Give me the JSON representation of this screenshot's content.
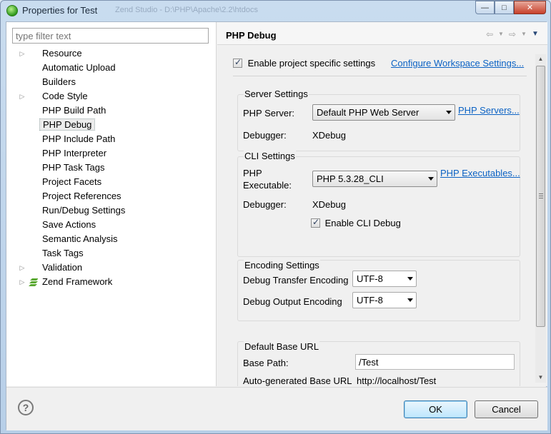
{
  "window": {
    "title": "Properties for Test",
    "ghost_title": "Zend Studio - D:\\PHP\\Apache\\2.2\\htdocs",
    "controls": {
      "minimize": "—",
      "maximize": "□",
      "close": "✕"
    }
  },
  "sidebar": {
    "filter_placeholder": "type filter text",
    "items": [
      {
        "label": "Resource",
        "expandable": true
      },
      {
        "label": "Automatic Upload",
        "expandable": false
      },
      {
        "label": "Builders",
        "expandable": false
      },
      {
        "label": "Code Style",
        "expandable": true
      },
      {
        "label": "PHP Build Path",
        "expandable": false
      },
      {
        "label": "PHP Debug",
        "expandable": false,
        "selected": true
      },
      {
        "label": "PHP Include Path",
        "expandable": false
      },
      {
        "label": "PHP Interpreter",
        "expandable": false
      },
      {
        "label": "PHP Task Tags",
        "expandable": false
      },
      {
        "label": "Project Facets",
        "expandable": false
      },
      {
        "label": "Project References",
        "expandable": false
      },
      {
        "label": "Run/Debug Settings",
        "expandable": false
      },
      {
        "label": "Save Actions",
        "expandable": false
      },
      {
        "label": "Semantic Analysis",
        "expandable": false
      },
      {
        "label": "Task Tags",
        "expandable": false
      },
      {
        "label": "Validation",
        "expandable": true
      },
      {
        "label": "Zend Framework",
        "expandable": true,
        "icon": "zend-framework-icon"
      }
    ]
  },
  "page": {
    "title": "PHP Debug",
    "nav_icons": [
      "back-arrow-icon",
      "back-dropdown-icon",
      "forward-arrow-icon",
      "forward-dropdown-icon",
      "view-menu-icon"
    ]
  },
  "main": {
    "enable_specific": {
      "label": "Enable project specific settings",
      "checked": true
    },
    "configure_link": "Configure Workspace Settings...",
    "server_settings": {
      "title": "Server Settings",
      "server_label": "PHP Server:",
      "server_value": "Default PHP Web Server",
      "servers_link": "PHP Servers...",
      "debugger_label": "Debugger:",
      "debugger_value": "XDebug"
    },
    "cli_settings": {
      "title": "CLI Settings",
      "exec_label_line1": "PHP",
      "exec_label_line2": "Executable:",
      "exec_value": "PHP 5.3.28_CLI",
      "executables_link": "PHP Executables...",
      "debugger_label": "Debugger:",
      "debugger_value": "XDebug",
      "enable_cli_debug": {
        "label": "Enable CLI Debug",
        "checked": true
      }
    },
    "encoding_settings": {
      "title": "Encoding Settings",
      "transfer_label": "Debug Transfer Encoding",
      "transfer_value": "UTF-8",
      "output_label": "Debug Output Encoding",
      "output_value": "UTF-8"
    },
    "base_url": {
      "title": "Default Base URL",
      "base_path_label": "Base Path:",
      "base_path_value": "/Test",
      "auto_label": "Auto-generated Base URL",
      "auto_value": "http://localhost/Test"
    }
  },
  "footer": {
    "help_symbol": "?",
    "ok_label": "OK",
    "cancel_label": "Cancel"
  }
}
